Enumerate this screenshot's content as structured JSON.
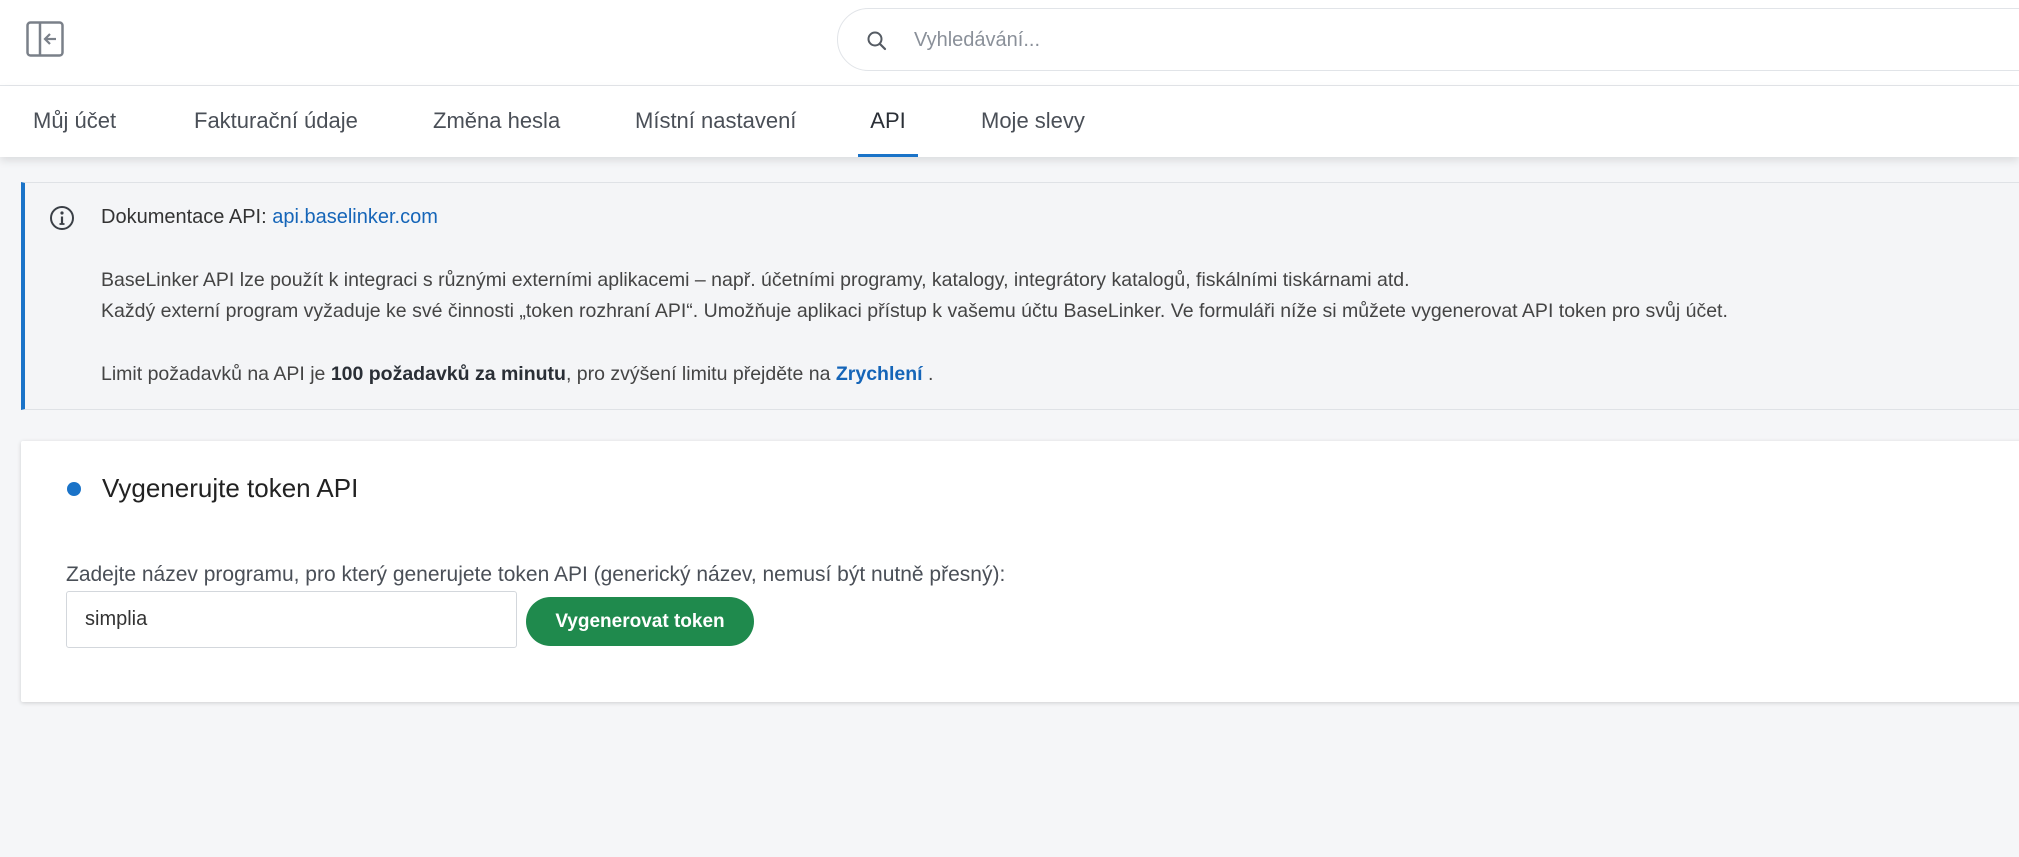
{
  "header": {
    "sidebar_toggle_icon": "sidebar-collapse-icon",
    "search": {
      "placeholder": "Vyhledávání...",
      "value": "",
      "icon": "search-icon"
    }
  },
  "tabs": [
    {
      "label": "Můj účet",
      "active": false
    },
    {
      "label": "Fakturační údaje",
      "active": false
    },
    {
      "label": "Změna hesla",
      "active": false
    },
    {
      "label": "Místní nastavení",
      "active": false
    },
    {
      "label": "API",
      "active": true
    },
    {
      "label": "Moje slevy",
      "active": false
    }
  ],
  "info": {
    "icon": "info-icon",
    "doc_prefix": "Dokumentace API:",
    "doc_link": "api.baselinker.com",
    "line1": "BaseLinker API lze použít k integraci s různými externími aplikacemi – např. účetními programy, katalogy, integrátory katalogů, fiskálními tiskárnami atd.",
    "line2": "Každý externí program vyžaduje ke své činnosti „token rozhraní API“. Umožňuje aplikaci přístup k vašemu účtu BaseLinker. Ve formuláři níže si můžete vygenerovat API token pro svůj účet.",
    "limit_prefix": "Limit požadavků na API je",
    "limit_value": "100 požadavků za minutu",
    "limit_middle": ", pro zvýšení limitu přejděte na",
    "limit_link": "Zrychlení",
    "limit_suffix": "."
  },
  "token_card": {
    "title": "Vygenerujte token API",
    "field_label": "Zadejte název programu, pro který generujete token API (generický název, nemusí být nutně přesný):",
    "program_value": "simplia",
    "button_label": "Vygenerovat token"
  },
  "colors": {
    "accent": "#1a73c8",
    "link": "#1565b8",
    "button": "#1f8a4d",
    "background": "#f5f6f8"
  }
}
